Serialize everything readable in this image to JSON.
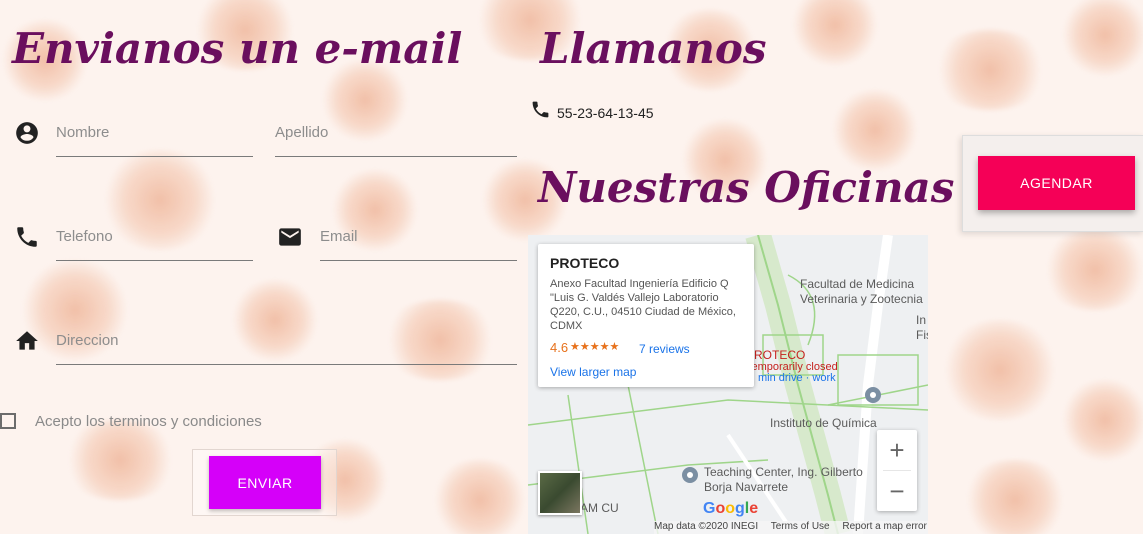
{
  "email_section": {
    "title": "Envianos un e-mail",
    "fields": {
      "nombre": "Nombre",
      "apellido": "Apellido",
      "telefono": "Telefono",
      "email": "Email",
      "direccion": "Direccion"
    },
    "terms": "Acepto los terminos y condiciones",
    "send_label": "ENVIAR"
  },
  "call_section": {
    "title": "Llamanos",
    "phone": "55-23-64-13-45"
  },
  "offices_section": {
    "title": "Nuestras Oficinas"
  },
  "agendar_label": "AGENDAR",
  "map": {
    "place_name": "PROTECO",
    "address": "Anexo Facultad Ingeniería Edificio Q \"Luis G. Valdés Vallejo Laboratorio Q220, C.U., 04510 Ciudad de México, CDMX",
    "rating": "4.6",
    "stars": "★★★★★",
    "reviews": "7 reviews",
    "view_larger": "View larger map",
    "labels": {
      "facultad": "Facultad de Medicina Veterinaria y Zootecnia",
      "in": "In Fis",
      "proteco_pin": "PROTECO",
      "closed": "Temporarily closed",
      "drive": "min drive · work",
      "quimica": "Instituto de Química",
      "teaching": "Teaching Center, Ing. Gilberto Borja Navarrete",
      "amcu": "AM CU"
    },
    "zoom_in": "+",
    "zoom_out": "−",
    "google": "Google",
    "footer": {
      "data": "Map data ©2020 INEGI",
      "terms": "Terms of Use",
      "report": "Report a map error"
    }
  },
  "colors": {
    "title": "#6a0f5e",
    "send": "#d500f9",
    "agendar": "#f50057"
  }
}
